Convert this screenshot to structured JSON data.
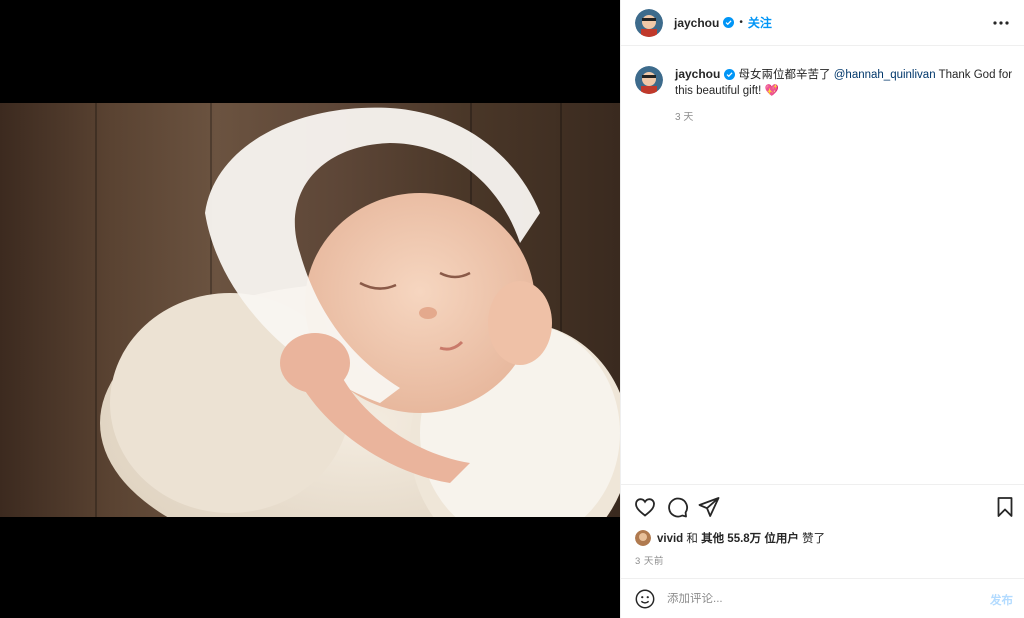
{
  "colors": {
    "accent": "#0095f6",
    "mention": "#00376b",
    "muted": "#8e8e8e",
    "heart": "#e84a8a"
  },
  "post": {
    "image_alt": "Sleeping newborn baby in white lace bonnet",
    "header": {
      "username": "jaychou",
      "separator": "•",
      "follow_label": "关注"
    },
    "caption": {
      "username": "jaychou",
      "text_before": " 母女兩位都辛苦了 ",
      "mention": "@hannah_quinlivan",
      "text_after": " Thank God for this beautiful gift! ",
      "emoji": "💖",
      "time": "3 天"
    },
    "actions": {
      "icons": [
        "heart-icon",
        "comment-icon",
        "share-icon",
        "bookmark-icon"
      ]
    },
    "likes": {
      "first_user": "vivid",
      "and": " 和 ",
      "others": "其他 55.8万 位用户",
      "suffix": " 赞了"
    },
    "time_ago": "3 天前",
    "comment": {
      "placeholder": "添加评论...",
      "post_label": "发布"
    }
  }
}
